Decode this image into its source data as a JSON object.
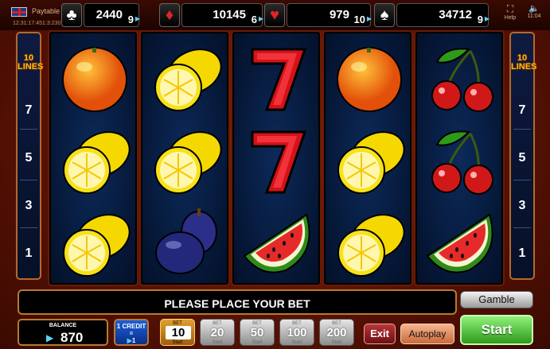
{
  "header": {
    "paytable_label": "Paytable",
    "game_id": "12:31:17:451:3:230",
    "help_label": "Help",
    "time": "11:04"
  },
  "jackpots": [
    {
      "suit": "clubs",
      "symbol": "♣",
      "value": "2440",
      "count": "9",
      "color": "#ffffff"
    },
    {
      "suit": "diamonds",
      "symbol": "♦",
      "value": "10145",
      "count": "6",
      "color": "#e0252a"
    },
    {
      "suit": "hearts",
      "symbol": "♥",
      "value": "979",
      "count": "10",
      "color": "#e0252a"
    },
    {
      "suit": "spades",
      "symbol": "♠",
      "value": "34712",
      "count": "9",
      "color": "#ffffff"
    }
  ],
  "lines_panel": {
    "count": "10",
    "label": "LINES",
    "numbers": [
      "7",
      "5",
      "3",
      "1"
    ]
  },
  "reels": [
    [
      "orange",
      "lemon",
      "lemon"
    ],
    [
      "lemon",
      "lemon",
      "plum"
    ],
    [
      "seven",
      "seven",
      "watermelon"
    ],
    [
      "orange",
      "lemon",
      "lemon"
    ],
    [
      "cherry",
      "cherry",
      "watermelon"
    ]
  ],
  "message": "PLEASE PLACE YOUR BET",
  "gamble_label": "Gamble",
  "balance": {
    "label": "BALANCE",
    "value": "870"
  },
  "credit": {
    "line1": "1 CREDIT",
    "line2": "=",
    "line3": "1"
  },
  "bets": {
    "top_label": "BET",
    "bottom_label": "Start",
    "values": [
      "10",
      "20",
      "50",
      "100",
      "200"
    ],
    "selected": "10"
  },
  "exit_label": "Exit",
  "autoplay_label": "Autoplay",
  "start_label": "Start"
}
